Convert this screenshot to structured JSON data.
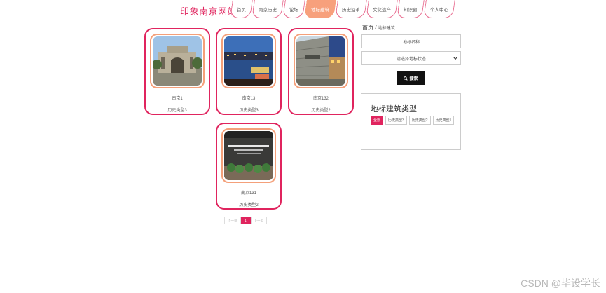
{
  "site": {
    "title": "印象南京网站"
  },
  "nav": {
    "tabs": [
      {
        "label": "首页",
        "active": false
      },
      {
        "label": "南京历史",
        "active": false
      },
      {
        "label": "论坛",
        "active": false
      },
      {
        "label": "地标建筑",
        "active": true
      },
      {
        "label": "历史沿革",
        "active": false
      },
      {
        "label": "文化遗产",
        "active": false
      },
      {
        "label": "知识窗",
        "active": false
      },
      {
        "label": "个人中心",
        "active": false
      }
    ]
  },
  "landmarks": [
    {
      "name": "南京1",
      "type": "历史类型3",
      "image": "building-photo"
    },
    {
      "name": "南京13",
      "type": "历史类型3",
      "image": "river-night-photo"
    },
    {
      "name": "南京132",
      "type": "历史类型2",
      "image": "stone-wall-photo"
    },
    {
      "name": "南京131",
      "type": "历史类型2",
      "image": "museum-sign-photo"
    }
  ],
  "pagination": {
    "prev": "上一页",
    "current": "1",
    "next": "下一页"
  },
  "breadcrumb": {
    "home": "首页",
    "separator": "/",
    "current": "地标建筑"
  },
  "search": {
    "name_placeholder": "地标名称",
    "status_select": "请选择地标状态",
    "button": "搜索"
  },
  "types": {
    "heading": "地标建筑类型",
    "tags": [
      {
        "label": "全部",
        "active": true
      },
      {
        "label": "历史类型3",
        "active": false
      },
      {
        "label": "历史类型2",
        "active": false
      },
      {
        "label": "历史类型1",
        "active": false
      }
    ]
  },
  "watermark": "CSDN @毕设学长",
  "colors": {
    "accent": "#e0245e",
    "active_tab": "#f7a07c",
    "frame": "#f4a07a"
  }
}
